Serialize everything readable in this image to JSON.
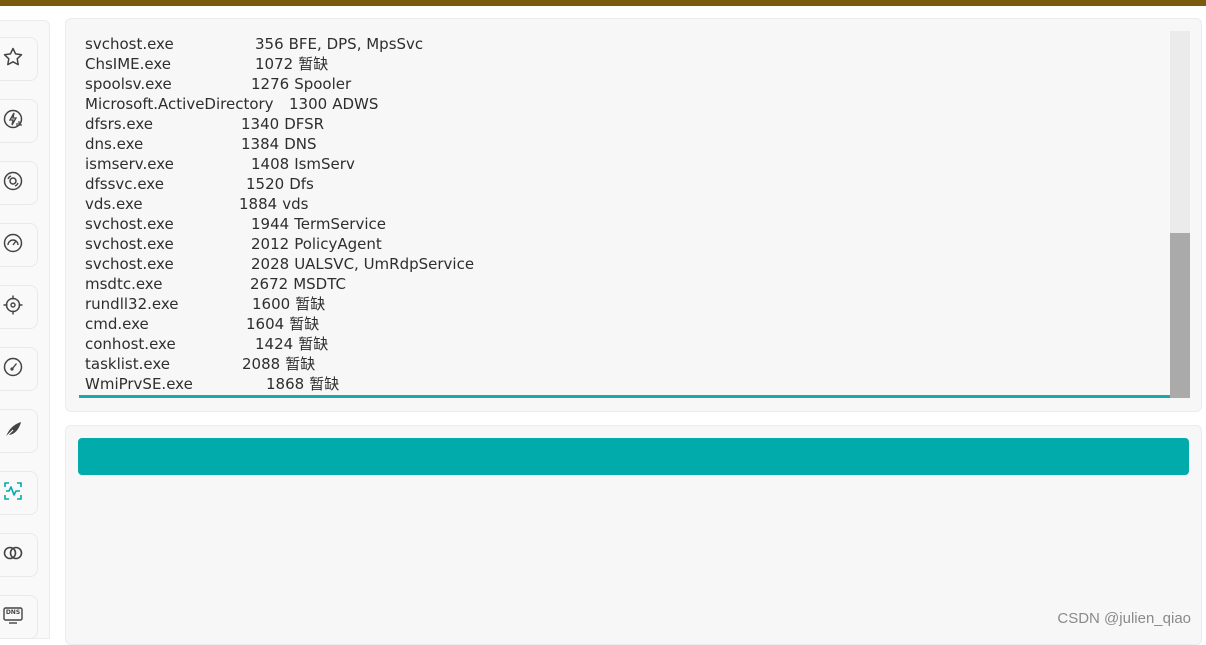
{
  "colors": {
    "top_bar": "#7a5a0e",
    "accent": "#02abab",
    "panel_bg": "#f7f7f7"
  },
  "sidebar": {
    "items": [
      {
        "name": "star-icon"
      },
      {
        "name": "lightning-chart-icon"
      },
      {
        "name": "disc-spin-icon"
      },
      {
        "name": "gauge-icon"
      },
      {
        "name": "crosshair-icon"
      },
      {
        "name": "speedometer-icon"
      },
      {
        "name": "feather-icon"
      },
      {
        "name": "scan-wave-icon",
        "active": true
      },
      {
        "name": "link-rings-icon"
      },
      {
        "name": "dns-icon",
        "label": "DNS"
      }
    ]
  },
  "output": {
    "lines": [
      {
        "name": "svchost.exe",
        "pid": "356",
        "services": "BFE, DPS, MpsSvc"
      },
      {
        "name": "ChsIME.exe",
        "pid": "1072",
        "services": "暂缺"
      },
      {
        "name": "spoolsv.exe",
        "pid": "1276",
        "services": "Spooler"
      },
      {
        "name": "Microsoft.ActiveDirectory",
        "pid": "1300",
        "services": "ADWS"
      },
      {
        "name": "dfsrs.exe",
        "pid": "1340",
        "services": "DFSR"
      },
      {
        "name": "dns.exe",
        "pid": "1384",
        "services": "DNS"
      },
      {
        "name": "ismserv.exe",
        "pid": "1408",
        "services": "IsmServ"
      },
      {
        "name": "dfssvc.exe",
        "pid": "1520",
        "services": "Dfs"
      },
      {
        "name": "vds.exe",
        "pid": "1884",
        "services": "vds"
      },
      {
        "name": "svchost.exe",
        "pid": "1944",
        "services": "TermService"
      },
      {
        "name": "svchost.exe",
        "pid": "2012",
        "services": "PolicyAgent"
      },
      {
        "name": "svchost.exe",
        "pid": "2028",
        "services": "UALSVC, UmRdpService"
      },
      {
        "name": "msdtc.exe",
        "pid": "2672",
        "services": "MSDTC"
      },
      {
        "name": "rundll32.exe",
        "pid": "1600",
        "services": "暂缺"
      },
      {
        "name": "cmd.exe",
        "pid": "1604",
        "services": "暂缺"
      },
      {
        "name": "conhost.exe",
        "pid": "1424",
        "services": "暂缺"
      },
      {
        "name": "tasklist.exe",
        "pid": "2088",
        "services": "暂缺"
      },
      {
        "name": "WmiPrvSE.exe",
        "pid": "1868",
        "services": "暂缺"
      }
    ],
    "scroll_position": 0.55,
    "scroll_visible_fraction": 0.45
  },
  "action_bar": {
    "label": ""
  },
  "watermark": "CSDN @julien_qiao"
}
